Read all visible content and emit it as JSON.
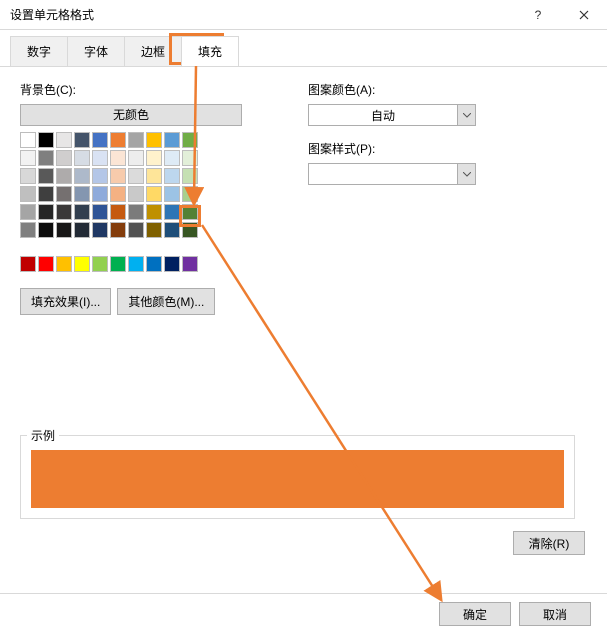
{
  "title": "设置单元格格式",
  "tabs": {
    "number": "数字",
    "font": "字体",
    "border": "边框",
    "fill": "填充"
  },
  "left": {
    "bgcolor_label": "背景色(C):",
    "nocolor": "无颜色",
    "fill_effect": "填充效果(I)...",
    "other_colors": "其他颜色(M)..."
  },
  "right": {
    "pattern_color_label": "图案颜色(A):",
    "pattern_color_value": "自动",
    "pattern_style_label": "图案样式(P):"
  },
  "sample": {
    "legend": "示例",
    "color": "#ed7d31"
  },
  "buttons": {
    "clear": "清除(R)",
    "ok": "确定",
    "cancel": "取消"
  },
  "palette": {
    "grid1": [
      [
        "#ffffff",
        "#000000",
        "#e7e6e6",
        "#44546a",
        "#4472c4",
        "#ed7d31",
        "#a5a5a5",
        "#ffc000",
        "#5b9bd5",
        "#70ad47"
      ],
      [
        "#f2f2f2",
        "#7f7f7f",
        "#d0cece",
        "#d6dce4",
        "#d9e2f3",
        "#fbe5d5",
        "#ededed",
        "#fff2cc",
        "#deebf6",
        "#e2efd9"
      ],
      [
        "#d8d8d8",
        "#595959",
        "#aeabab",
        "#adb9ca",
        "#b4c6e7",
        "#f7cbac",
        "#dbdbdb",
        "#fee599",
        "#bdd7ee",
        "#c5e0b3"
      ],
      [
        "#bfbfbf",
        "#3f3f3f",
        "#757070",
        "#8496b0",
        "#8eaadb",
        "#f4b183",
        "#c9c9c9",
        "#ffd965",
        "#9cc3e5",
        "#a8d08d"
      ],
      [
        "#a5a5a5",
        "#262626",
        "#3a3838",
        "#323f4f",
        "#2f5496",
        "#c55a11",
        "#7b7b7b",
        "#bf9000",
        "#2e75b5",
        "#538135"
      ],
      [
        "#7f7f7f",
        "#0c0c0c",
        "#171616",
        "#222a35",
        "#1f3864",
        "#833c0b",
        "#525252",
        "#7f6000",
        "#1e4e79",
        "#375623"
      ]
    ],
    "grid2": [
      [
        "#c00000",
        "#ff0000",
        "#ffc000",
        "#ffff00",
        "#92d050",
        "#00b050",
        "#00b0f0",
        "#0070c0",
        "#002060",
        "#7030a0"
      ]
    ]
  }
}
